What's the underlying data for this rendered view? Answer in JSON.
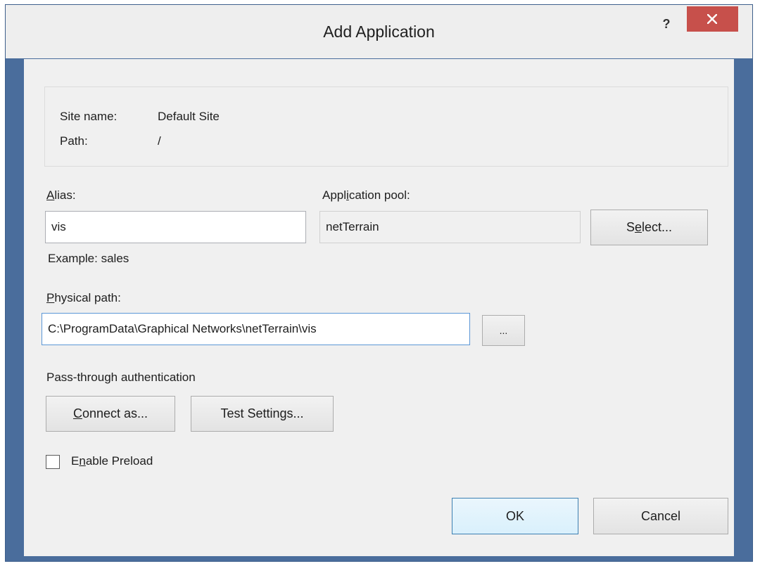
{
  "window": {
    "title": "Add Application",
    "help_label": "?"
  },
  "site_info": {
    "site_name_label": "Site name:",
    "site_name_value": "Default Site",
    "path_label": "Path:",
    "path_value": "/"
  },
  "alias": {
    "label_access_key": "A",
    "label_rest": "lias:",
    "value": "vis",
    "example": "Example: sales"
  },
  "app_pool": {
    "label_pre": "Appl",
    "label_access_key": "i",
    "label_post": "cation pool:",
    "value": "netTerrain",
    "select_pre": "S",
    "select_access_key": "e",
    "select_post": "lect..."
  },
  "physical_path": {
    "label_access_key": "P",
    "label_rest": "hysical path:",
    "value": "C:\\ProgramData\\Graphical Networks\\netTerrain\\vis",
    "browse_label": "..."
  },
  "auth": {
    "heading": "Pass-through authentication",
    "connect_access_key": "C",
    "connect_rest": "onnect as...",
    "test_pre": "Test Settin",
    "test_access_key": "g",
    "test_post": "s..."
  },
  "preload": {
    "label_pre": "E",
    "label_access_key": "n",
    "label_post": "able Preload",
    "checked": false
  },
  "footer": {
    "ok_label": "OK",
    "cancel_label": "Cancel"
  }
}
